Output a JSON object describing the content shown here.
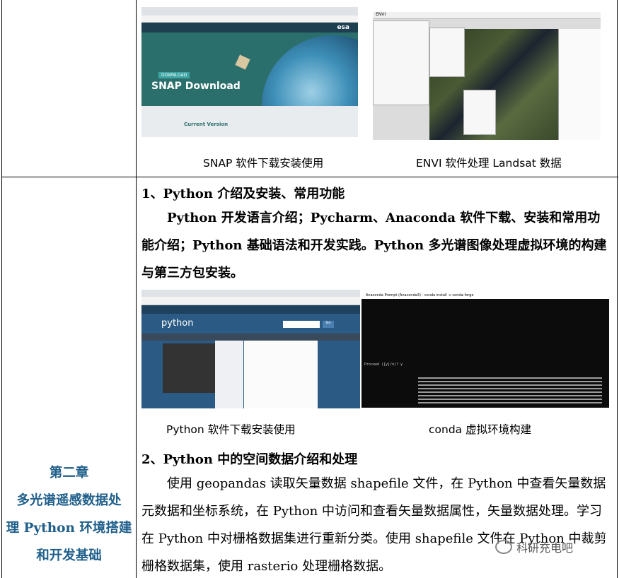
{
  "row1": {
    "snap_caption": "SNAP 软件下载安装使用",
    "envi_caption": "ENVI 软件处理 Landsat 数据",
    "snap_shot": {
      "page_heading": "SNAP Download",
      "badge": "DOWNLOAD",
      "subtitle": "Current Version",
      "brand": "esa"
    },
    "envi_shot": {
      "title": "ENVI"
    }
  },
  "row2": {
    "chapter_label": "第二章",
    "chapter_title_lines": [
      "多光谱遥感数据处",
      "理 Python 环境搭建",
      "和开发基础"
    ],
    "s1_heading": "1、Python 介绍及安装、常用功能",
    "s1_para": "Python 开发语言介绍；Pycharm、Anaconda 软件下载、安装和常用功能介绍；Python 基础语法和开发实践。Python 多光谱图像处理虚拟环境的构建与第三方包安装。",
    "python_caption": "Python 软件下载安装使用",
    "conda_caption": "conda 虚拟环境构建",
    "python_shot": {
      "logo": "python",
      "search_button": "Go"
    },
    "conda_shot": {
      "title": "Anaconda Prompt (Anaconda3) - conda install -c conda-forge",
      "prompt": "Proceed ([y]/n)? y"
    },
    "s2_heading": "2、Python 中的空间数据介绍和处理",
    "s2_para": "使用 geopandas 读取矢量数据 shapefile 文件，在 Python 中查看矢量数据元数据和坐标系统，在 Python 中访问和查看矢量数据属性，矢量数据处理。学习在 Python 中对栅格数据集进行重新分类。使用 shapefile 文件在 Python 中裁剪栅格数据集，使用 rasterio 处理栅格数据。"
  },
  "watermark": "科研充电吧"
}
